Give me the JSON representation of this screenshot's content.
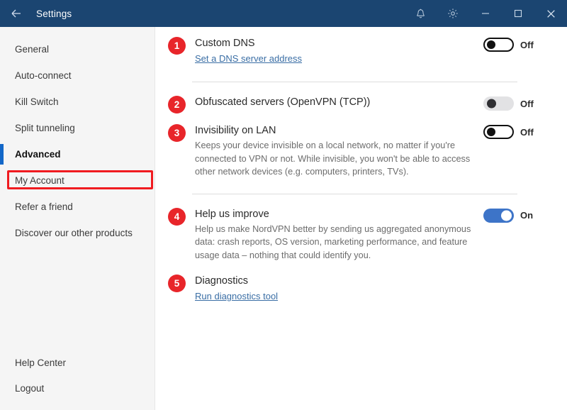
{
  "window": {
    "title": "Settings",
    "back_icon": "back-arrow-icon",
    "titlebar_color": "#1b4571",
    "buttons": {
      "notifications": "bell-icon",
      "settings": "gear-icon",
      "minimize": "minimize-icon",
      "maximize": "maximize-icon",
      "close": "close-icon"
    }
  },
  "sidebar": {
    "items": [
      {
        "label": "General",
        "active": false
      },
      {
        "label": "Auto-connect",
        "active": false
      },
      {
        "label": "Kill Switch",
        "active": false
      },
      {
        "label": "Split tunneling",
        "active": false
      },
      {
        "label": "Advanced",
        "active": true
      },
      {
        "label": "My Account",
        "active": false
      },
      {
        "label": "Refer a friend",
        "active": false
      },
      {
        "label": "Discover our other products",
        "active": false
      }
    ],
    "bottom_items": [
      {
        "label": "Help Center"
      },
      {
        "label": "Logout"
      }
    ],
    "active_accent_color": "#1367c8",
    "annotation_color": "#f01b20"
  },
  "settings": {
    "rows": [
      {
        "badge": "1",
        "title": "Custom DNS",
        "link": "Set a DNS server address",
        "desc": "",
        "toggle_state": "off",
        "toggle_label": "Off"
      },
      {
        "badge": "2",
        "title": "Obfuscated servers (OpenVPN (TCP))",
        "link": "",
        "desc": "",
        "toggle_state": "disabled",
        "toggle_label": "Off"
      },
      {
        "badge": "3",
        "title": "Invisibility on LAN",
        "link": "",
        "desc": "Keeps your device invisible on a local network, no matter if you're connected to VPN or not. While invisible, you won't be able to access other network devices (e.g. computers, printers, TVs).",
        "toggle_state": "off",
        "toggle_label": "Off"
      },
      {
        "badge": "4",
        "title": "Help us improve",
        "link": "",
        "desc": "Help us make NordVPN better by sending us aggregated anonymous data: crash reports, OS version, marketing performance, and feature usage data – nothing that could identify you.",
        "toggle_state": "on",
        "toggle_label": "On"
      },
      {
        "badge": "5",
        "title": "Diagnostics",
        "link": "Run diagnostics tool",
        "desc": "",
        "toggle_state": "none",
        "toggle_label": ""
      }
    ],
    "badge_color": "#e8252a",
    "link_color": "#3a6ea5",
    "toggle_on_color": "#3d74c8"
  }
}
